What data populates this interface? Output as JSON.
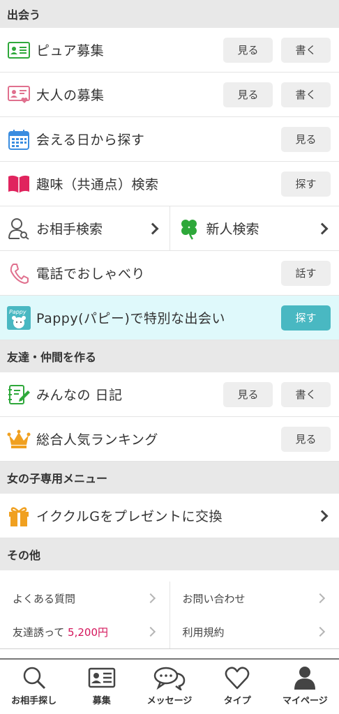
{
  "sections": {
    "meet": "出会う",
    "friends": "友達・仲間を作る",
    "girls": "女の子専用メニュー",
    "other": "その他"
  },
  "meet_items": {
    "pure": {
      "label": "ピュア募集",
      "btn_view": "見る",
      "btn_write": "書く"
    },
    "adult": {
      "label": "大人の募集",
      "btn_view": "見る",
      "btn_write": "書く"
    },
    "date": {
      "label": "会える日から探す",
      "btn_view": "見る"
    },
    "hobby": {
      "label": "趣味（共通点）検索",
      "btn_search": "探す"
    },
    "partner_search": {
      "label": "お相手検索"
    },
    "newcomer_search": {
      "label": "新人検索"
    },
    "phone": {
      "label": "電話でおしゃべり",
      "btn_talk": "話す"
    },
    "pappy": {
      "label": "Pappy(パピー)で特別な出会い",
      "btn_search": "探す",
      "logo_text": "Pappy"
    }
  },
  "friend_items": {
    "diary": {
      "label": "みんなの 日記",
      "btn_view": "見る",
      "btn_write": "書く"
    },
    "ranking": {
      "label": "総合人気ランキング",
      "btn_view": "見る"
    }
  },
  "girls_items": {
    "gift": {
      "label": "イククルGをプレゼントに交換"
    }
  },
  "other_items": {
    "faq": "よくある質問",
    "contact": "お問い合わせ",
    "invite": "友達誘って",
    "invite_amount": "5,200円",
    "terms": "利用規約"
  },
  "tabbar": {
    "search": "お相手探し",
    "recruit": "募集",
    "message": "メッセージ",
    "type": "タイプ",
    "mypage": "マイページ"
  },
  "colors": {
    "accent_teal": "#49b8c2",
    "pappy_bg": "#dff9fb",
    "pink": "#d4145a",
    "green": "#2ea83a",
    "blue": "#3a8de0",
    "orange": "#f0a020"
  }
}
